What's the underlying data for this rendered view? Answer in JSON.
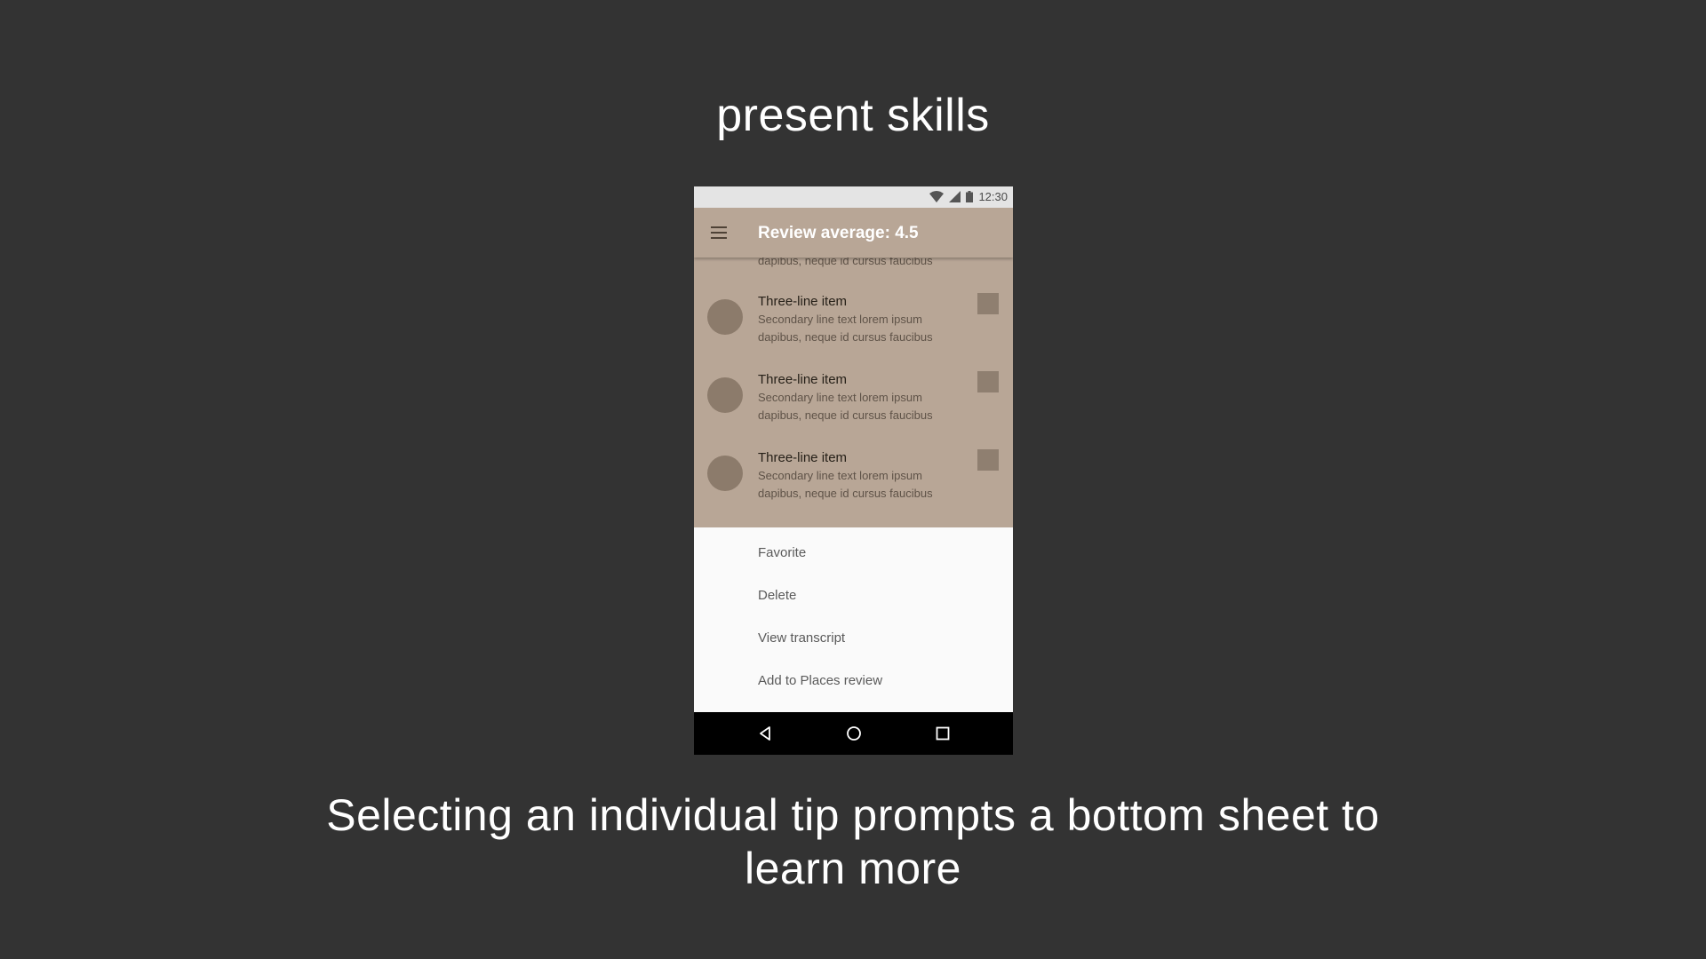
{
  "slide": {
    "title": "present skills",
    "caption": "Selecting an individual tip prompts a bottom sheet to learn more"
  },
  "status_bar": {
    "time": "12:30",
    "icons": [
      "wifi-icon",
      "cellular-signal-icon",
      "battery-icon"
    ]
  },
  "app_bar": {
    "menu_icon": "hamburger-menu-icon",
    "title": "Review average: 4.5"
  },
  "list": {
    "partial_line": "dapibus, neque id cursus faucibus",
    "items": [
      {
        "primary": "Three-line item",
        "secondary_1": "Secondary line text lorem ipsum",
        "secondary_2": "dapibus, neque id cursus faucibus"
      },
      {
        "primary": "Three-line item",
        "secondary_1": "Secondary line text lorem ipsum",
        "secondary_2": "dapibus, neque id cursus faucibus"
      },
      {
        "primary": "Three-line item",
        "secondary_1": "Secondary line text lorem ipsum",
        "secondary_2": "dapibus, neque id cursus faucibus"
      }
    ]
  },
  "bottom_sheet": {
    "items": [
      "Favorite",
      "Delete",
      "View transcript",
      "Add to Places review"
    ]
  },
  "nav_bar": {
    "buttons": [
      "back-icon",
      "home-icon",
      "recents-icon"
    ]
  },
  "colors": {
    "background": "#333333",
    "app_surface": "#b8a696",
    "avatar": "#8c7b6b",
    "sheet": "#fafafa",
    "nav_bar": "#000000"
  }
}
